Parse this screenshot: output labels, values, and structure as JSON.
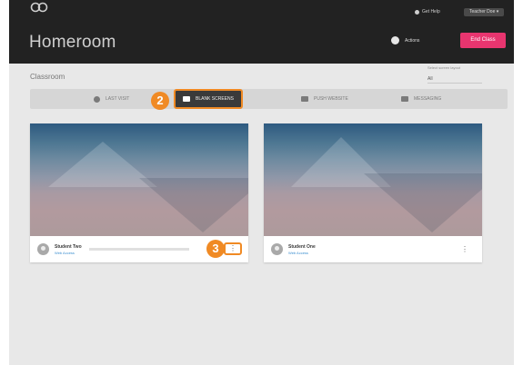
{
  "app": {
    "title": "Homeroom"
  },
  "topbar": {
    "user_link": "Get Help",
    "teacher_menu": "Teacher Doe ▾",
    "actions_label": "Actions",
    "end_class_label": "End Class"
  },
  "section": {
    "label": "Classroom",
    "right_label": "Select screen layout",
    "right_value": "All"
  },
  "tabs": [
    {
      "label": "LAST VISIT"
    },
    {
      "label": "BLANK SCREENS"
    },
    {
      "label": "PUSH WEBSITE"
    },
    {
      "label": "MESSAGING"
    }
  ],
  "callouts": {
    "tab": "2",
    "menu": "3"
  },
  "cards": [
    {
      "name": "Student Two",
      "sub": "Web Access",
      "more": "⋮"
    },
    {
      "name": "Student One",
      "sub": "Web Access",
      "more": "⋮"
    }
  ],
  "colors": {
    "accent": "#e8356f",
    "callout": "#f08a24",
    "topbar": "#222222"
  }
}
